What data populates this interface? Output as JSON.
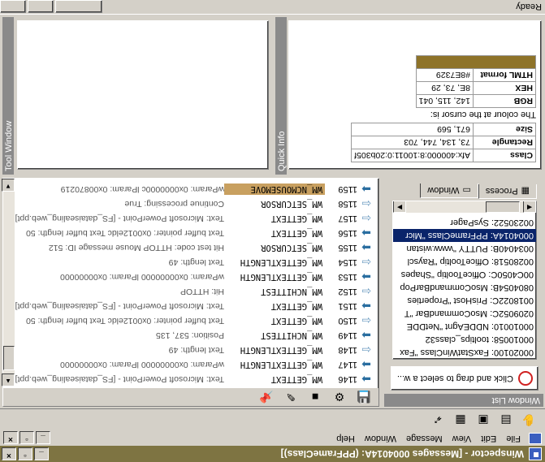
{
  "window": {
    "title": "Winspector - [Messages 0004014A: (PPFrameClass)]",
    "controls": [
      "minimize",
      "maximize",
      "close"
    ]
  },
  "menu": [
    "File",
    "Edit",
    "View",
    "Message",
    "Window",
    "Help"
  ],
  "toolbar_icons": [
    "hand-icon",
    "drop-icon",
    "window-icon",
    "tree-icon",
    "pointer-icon"
  ],
  "window_list": {
    "title": "Window List",
    "tabs": [
      "Window",
      "Process"
    ],
    "active_tab": "Window",
    "items": [
      "00020100: FaxStatWinClass \"Fax",
      "00010058: tooltips_class32",
      "00010010: NDDEAgnt \"NetDDE",
      "0209052C: MsoCommandBar \"T",
      "0018022C: PrisHost \"Properties",
      "0804054B: MsoCommandBarPop",
      "00C4050C: OfficeTooltip \"Shapes",
      "00280518: OfficeTooltip \"Rayscl",
      "0034040B: PUTTY \"www.wistan",
      "0004014A: PPFrameClass \"Micr",
      "00230522: SysPager"
    ],
    "selected_index": 9,
    "drag_hint": "Click and drag to select a w..."
  },
  "messages": {
    "rows": [
      {
        "dir": "out",
        "num": "1146",
        "name": "WM_GETTEXT",
        "params": "Text: Microsoft PowerPoint - [FS_dataisealing_web.ppt]"
      },
      {
        "dir": "out",
        "num": "1147",
        "name": "WM_GETTEXTLENGTH",
        "params": "wParam: 0x00000000  lParam: 0x00000000"
      },
      {
        "dir": "in",
        "num": "1148",
        "name": "WM_GETTEXTLENGTH",
        "params": "Text length: 49"
      },
      {
        "dir": "out",
        "num": "1149",
        "name": "WM_NCHITTEST",
        "params": "Position: 537, 135"
      },
      {
        "dir": "in",
        "num": "1150",
        "name": "WM_GETTEXT",
        "params": "Text buffer pointer: 0x0012eldc  Text buffer length: 50"
      },
      {
        "dir": "out",
        "num": "1151",
        "name": "WM_GETTEXT",
        "params": "Text: Microsoft PowerPoint - [FS_dataisealing_web.ppt]"
      },
      {
        "dir": "in",
        "num": "1152",
        "name": "WM_NCHITTEST",
        "params": "Hit: HTTOP"
      },
      {
        "dir": "out",
        "num": "1153",
        "name": "WM_GETTEXTLENGTH",
        "params": "wParam: 0x00000000  lParam: 0x00000000"
      },
      {
        "dir": "in",
        "num": "1154",
        "name": "WM_GETTEXTLENGTH",
        "params": "Text length: 49"
      },
      {
        "dir": "out",
        "num": "1155",
        "name": "WM_SETCURSOR",
        "params": "Hit test code: HTTOP  Mouse message ID: 512"
      },
      {
        "dir": "out",
        "num": "1156",
        "name": "WM_GETTEXT",
        "params": "Text buffer pointer: 0x0012eldc  Text buffer length: 50"
      },
      {
        "dir": "in",
        "num": "1157",
        "name": "WM_GETTEXT",
        "params": "Text: Microsoft PowerPoint - [FS_dataisealing_web.ppt]"
      },
      {
        "dir": "in",
        "num": "1158",
        "name": "WM_SETCURSOR",
        "params": "Continue processing: True"
      },
      {
        "dir": "out",
        "num": "1159",
        "name": "WM_NCMOUSEMOVE",
        "params": "wParam: 0x0000000c  lParam: 0x00870219",
        "highlight": true
      }
    ]
  },
  "message_toolbar_icons": [
    "save-icon",
    "filter-icon",
    "stop-icon",
    "edit-icon",
    "pin-icon"
  ],
  "quick_info": {
    "title": "Quick Info",
    "window_rows": [
      {
        "k": "Class",
        "v": "Afx:400000:8:10011:0:20b305f"
      },
      {
        "k": "Rectangle",
        "v": "73, 134, 744, 703"
      },
      {
        "k": "Size",
        "v": "671, 569"
      }
    ],
    "colour_caption": "The colour at the cursor is:",
    "colour_rows": [
      {
        "k": "RGB",
        "v": "142, 115, 041"
      },
      {
        "k": "HEX",
        "v": "8E, 73, 29"
      },
      {
        "k": "HTML format",
        "v": "#8E7329"
      }
    ],
    "swatch_color": "#8e7329"
  },
  "tool_window": {
    "title": "Tool Window"
  },
  "status": {
    "text": "Ready"
  },
  "colors": {
    "accent": "#7e7442",
    "highlight": "#c8a060",
    "selection": "#0a246a"
  }
}
